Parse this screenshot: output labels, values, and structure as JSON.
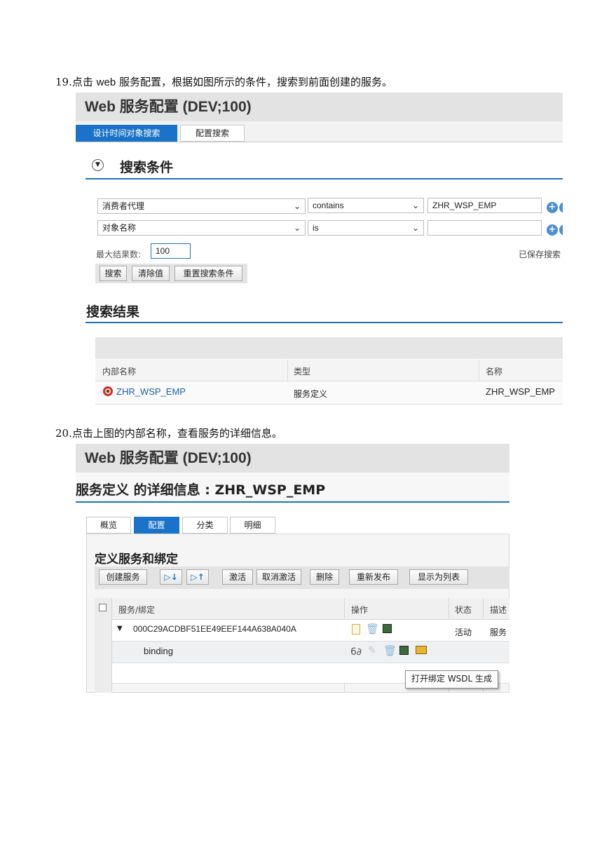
{
  "step19": {
    "number": "19.",
    "text_a": "点击 ",
    "text_web": "web",
    "text_b": " 服务配置，根据如图所示的条件，搜索到前面创建的服务。"
  },
  "shot1": {
    "app_title": "Web 服务配置 (DEV;100)",
    "tabs": [
      "设计时间对象搜索",
      "配置搜索"
    ],
    "search_section_title": "搜索条件",
    "criteria": [
      {
        "field": "消费者代理",
        "operator": "contains",
        "value": "ZHR_WSP_EMP"
      },
      {
        "field": "对象名称",
        "operator": "is",
        "value": ""
      }
    ],
    "max_results_label": "最大结果数:",
    "max_results_value": "100",
    "saved_search_label": "已保存搜索",
    "buttons": [
      "搜索",
      "清除值",
      "重置搜索条件"
    ],
    "results_section_title": "搜索结果",
    "result_columns": [
      "内部名称",
      "类型",
      "名称"
    ],
    "result_row": {
      "internal_name": "ZHR_WSP_EMP",
      "type": "服务定义",
      "name": "ZHR_WSP_EMP"
    }
  },
  "step20": {
    "number": "20.",
    "text": "点击上图的内部名称，查看服务的详细信息。"
  },
  "shot2": {
    "app_title": "Web 服务配置 (DEV;100)",
    "detail_title": "服务定义 的详细信息 : ZHR_WSP_EMP",
    "tabs": [
      "概览",
      "配置",
      "分类",
      "明细"
    ],
    "active_tab_index": 1,
    "section_title": "定义服务和绑定",
    "toolbar": {
      "create": "创建服务",
      "activate": "激活",
      "deactivate": "取消激活",
      "delete": "删除",
      "republish": "重新发布",
      "show_list": "显示为列表"
    },
    "columns": [
      "服务/绑定",
      "操作",
      "状态",
      "描述"
    ],
    "rows": [
      {
        "name": "000C29ACDBF51EE49EEF144A638A040A",
        "status": "活动",
        "desc": "服务"
      },
      {
        "name": "binding",
        "status": "",
        "desc": ""
      }
    ],
    "tooltip": "打开绑定 WSDL 生成"
  },
  "colors": {
    "accent": "#1a73c8",
    "link": "#1a5fa8",
    "header_bg": "#e3e3e3"
  }
}
